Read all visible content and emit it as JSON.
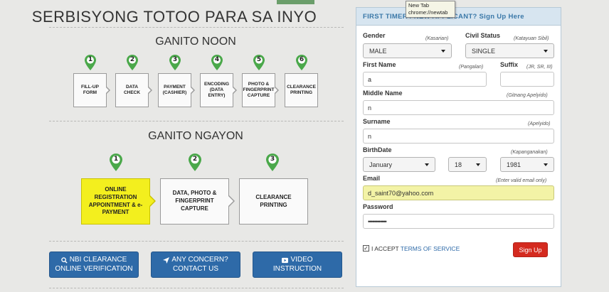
{
  "left": {
    "title": "SERBISYONG TOTOO PARA SA INYO",
    "noon_title": "GANITO NOON",
    "ngayon_title": "GANITO NGAYON",
    "old_steps": [
      {
        "num": "1",
        "label": "FILL-UP FORM"
      },
      {
        "num": "2",
        "label": "DATA CHECK"
      },
      {
        "num": "3",
        "label": "PAYMENT (CASHIER)"
      },
      {
        "num": "4",
        "label": "ENCODING (DATA ENTRY)"
      },
      {
        "num": "5",
        "label": "PHOTO & FINGERPRINT CAPTURE"
      },
      {
        "num": "6",
        "label": "CLEARANCE PRINTING"
      }
    ],
    "new_steps": [
      {
        "num": "1",
        "label": "ONLINE REGISTRATION APPOINTMENT & e-PAYMENT"
      },
      {
        "num": "2",
        "label": "DATA, PHOTO & FINGERPRINT CAPTURE"
      },
      {
        "num": "3",
        "label": "CLEARANCE PRINTING"
      }
    ],
    "buttons": [
      {
        "line1": "NBI CLEARANCE",
        "line2": "ONLINE VERIFICATION",
        "icon": "search-icon"
      },
      {
        "line1": "ANY CONCERN?",
        "line2": "CONTACT US",
        "icon": "send-icon"
      },
      {
        "line1": "VIDEO",
        "line2": "INSTRUCTION",
        "icon": "video-icon"
      }
    ]
  },
  "form": {
    "header": "FIRST TIMER / ",
    "header_hidden": "NEW APPLICANT? ",
    "header_tail": "Sign Up Here",
    "gender": {
      "label": "Gender",
      "hint": "(Kasarian)",
      "value": "MALE"
    },
    "civil_status": {
      "label": "Civil Status",
      "hint": "(Katayuan Sibil)",
      "value": "SINGLE"
    },
    "first_name": {
      "label": "First Name",
      "hint": "(Pangalan)",
      "value": "a"
    },
    "suffix": {
      "label": "Suffix",
      "hint": "(JR, SR, III)",
      "value": ""
    },
    "middle_name": {
      "label": "Middle Name",
      "hint": "(Gitnang Apelyido)",
      "value": "n"
    },
    "surname": {
      "label": "Surname",
      "hint": "(Apelyido)",
      "value": "n"
    },
    "birthdate": {
      "label": "BirthDate",
      "hint": "(Kapanganakan)",
      "month": "January",
      "day": "18",
      "year": "1981"
    },
    "email": {
      "label": "Email",
      "hint": "(Enter valid email only)",
      "value": "d_saint70@yahoo.com"
    },
    "password": {
      "label": "Password",
      "value": "••••••••••••"
    },
    "accept_text": "I ACCEPT ",
    "terms_link": "TERMS OF SERVICE",
    "signup_label": "Sign Up",
    "checkbox_mark": "✓"
  },
  "tooltip": {
    "line1": "New Tab",
    "line2": "chrome://newtab"
  },
  "colors": {
    "accent_blue": "#2e6aa8",
    "highlight_yellow": "#f3ef1e",
    "signup_red": "#d42a1f",
    "pin_green": "#4aa84a"
  }
}
